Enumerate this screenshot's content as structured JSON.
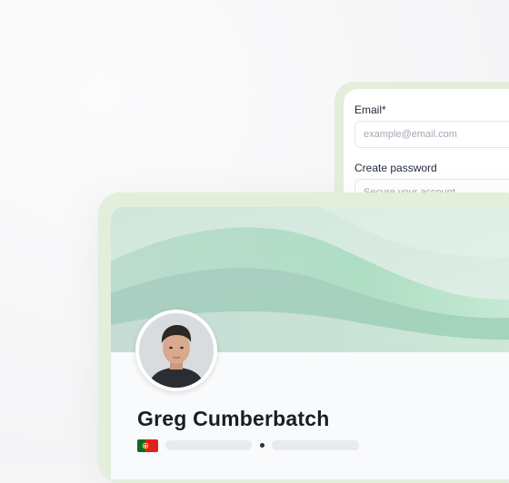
{
  "signup": {
    "email_label": "Email*",
    "email_placeholder": "example@email.com",
    "password_label": "Create password",
    "password_placeholder": "Secure your account"
  },
  "profile": {
    "name": "Greg Cumberbatch",
    "country_flag": "portugal-flag-icon"
  },
  "colors": {
    "frame_green": "#e3eedb",
    "cover_mint": "#a9dcc0",
    "cover_sage": "#b9d3c8"
  }
}
